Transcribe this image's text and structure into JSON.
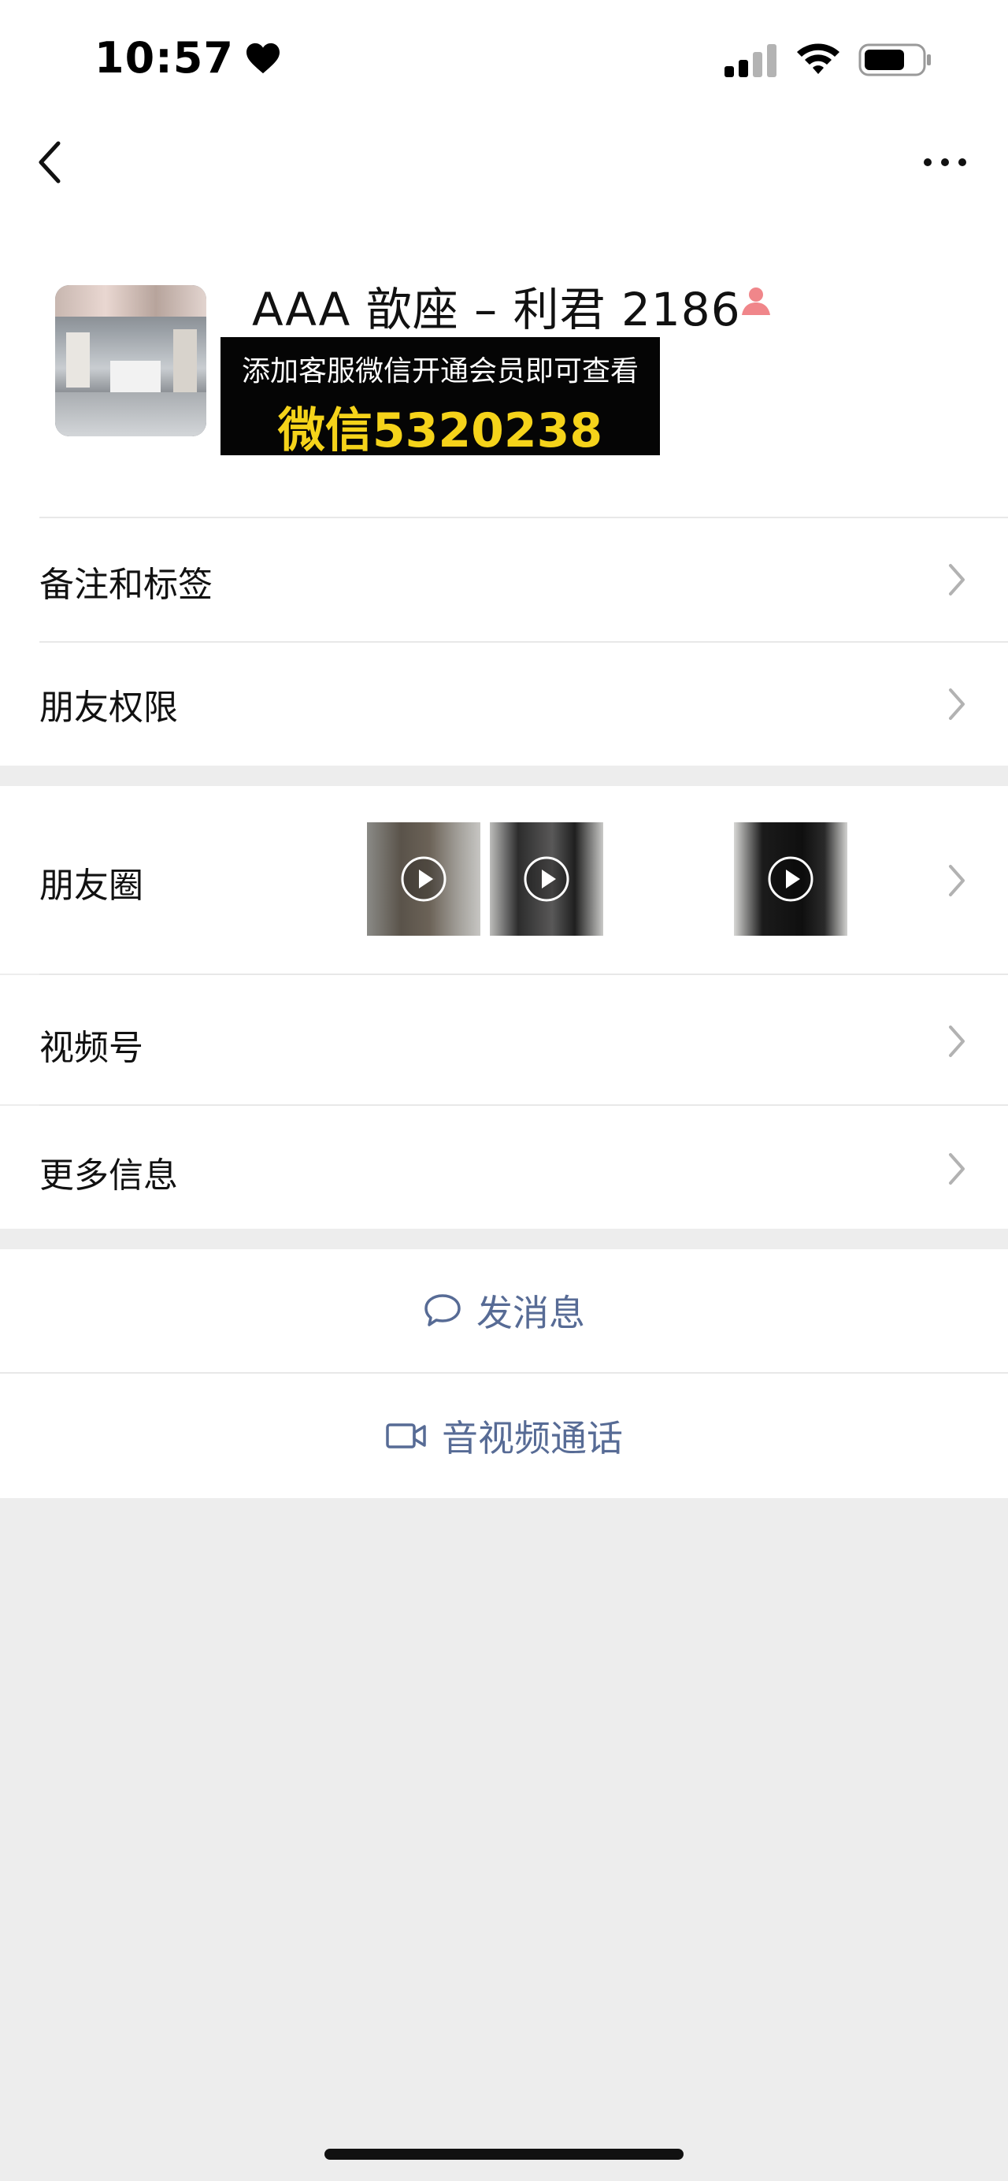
{
  "status_bar": {
    "time": "10:57",
    "icons": [
      "heart-icon",
      "signal-icon",
      "wifi-icon",
      "battery-icon"
    ]
  },
  "nav": {
    "back_icon": "chevron-left-icon",
    "more_icon": "more-dots-icon"
  },
  "profile": {
    "name": "AAA 歆座 – 利君 2186",
    "gender_icon": "person-icon",
    "gender_color": "#f0868a"
  },
  "promo": {
    "line1": "添加客服微信开通会员即可查看",
    "line2": "微信5320238",
    "highlight_color": "#f5d31a"
  },
  "menu": {
    "remarks_tags": "备注和标签",
    "friend_permissions": "朋友权限",
    "moments": "朋友圈",
    "channels": "视频号",
    "more_info": "更多信息"
  },
  "actions": {
    "send_message": "发消息",
    "av_call": "音视频通话",
    "link_color": "#576b95"
  }
}
